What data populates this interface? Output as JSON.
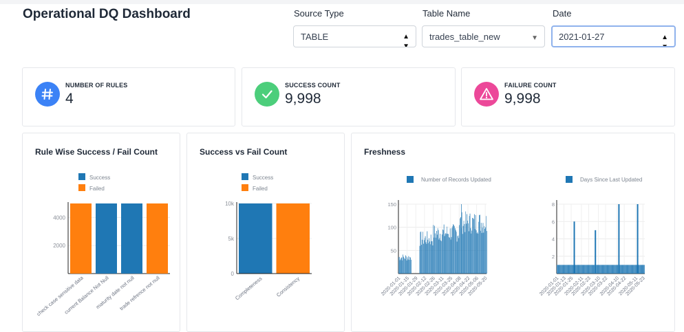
{
  "page": {
    "title": "Operational DQ Dashboard"
  },
  "filters": {
    "source_type": {
      "label": "Source Type",
      "value": "TABLE"
    },
    "table_name": {
      "label": "Table Name",
      "value": "trades_table_new"
    },
    "date": {
      "label": "Date",
      "value": "2021-01-27"
    }
  },
  "stats": {
    "rules": {
      "label": "NUMBER OF RULES",
      "value": "4",
      "icon": "hash-icon",
      "color": "#3b82f6"
    },
    "success": {
      "label": "SUCCESS COUNT",
      "value": "9,998",
      "icon": "check-icon",
      "color": "#4cce7b"
    },
    "failure": {
      "label": "FAILURE COUNT",
      "value": "9,998",
      "icon": "warning-icon",
      "color": "#ec4899"
    }
  },
  "colors": {
    "success": "#1f77b4",
    "failed": "#ff7f0e",
    "fresh": "#1f77b4"
  },
  "chart_titles": {
    "rule_wise": "Rule Wise Success / Fail Count",
    "success_vs_fail": "Success vs Fail Count",
    "freshness": "Freshness"
  },
  "chart_data": [
    {
      "type": "bar",
      "title": "Rule Wise Success / Fail Count",
      "legend": [
        "Success",
        "Failed"
      ],
      "legend_position": "top",
      "categories": [
        "check case sensitive data",
        "current Balance Not Null",
        "maturity date not null",
        "trade refrence not null"
      ],
      "values": [
        5000,
        5000,
        5000,
        5000
      ],
      "status": [
        "Failed",
        "Success",
        "Success",
        "Failed"
      ],
      "ylim": [
        0,
        5000
      ],
      "yticks": [
        "2000",
        "4000"
      ]
    },
    {
      "type": "bar",
      "title": "Success vs Fail Count",
      "legend": [
        "Success",
        "Failed"
      ],
      "legend_position": "top",
      "categories": [
        "Completeness",
        "Consistency"
      ],
      "values": [
        10000,
        10000
      ],
      "status": [
        "Success",
        "Failed"
      ],
      "ylim": [
        0,
        10000
      ],
      "yticks": [
        "0",
        "5k",
        "10k"
      ]
    },
    {
      "type": "bar",
      "title": "Number of Records Updated",
      "legend": [
        "Number of Records Updated"
      ],
      "ylim": [
        0,
        150
      ],
      "yticks": [
        "50",
        "100",
        "150"
      ],
      "xticks": [
        "2020-01-01",
        "2020-01-15",
        "2020-01-29",
        "2020-02-12",
        "2020-02-26",
        "2020-03-11",
        "2020-03-25",
        "2020-04-08",
        "2020-04-22",
        "2020-05-06",
        "2020-05-20"
      ],
      "segments": [
        {
          "start": "2020-01-01",
          "end": "2020-01-21",
          "value": 35
        },
        {
          "start": "2020-01-22",
          "end": "2020-02-03",
          "value": 0
        },
        {
          "start": "2020-02-04",
          "end": "2020-02-25",
          "value": 75
        },
        {
          "start": "2020-02-26",
          "end": "2020-04-07",
          "value": 88
        },
        {
          "start": "2020-04-08",
          "end": "2020-05-22",
          "value": 110
        }
      ],
      "peak": {
        "x": "2020-04-11",
        "value": 150
      }
    },
    {
      "type": "bar",
      "title": "Days Since Last Updated",
      "legend": [
        "Days Since Last Updated"
      ],
      "ylim": [
        0,
        8
      ],
      "yticks": [
        "2",
        "4",
        "6",
        "8"
      ],
      "xticks": [
        "2020-01-01",
        "2020-01-13",
        "2020-01-25",
        "2020-02-11",
        "2020-02-23",
        "2020-03-10",
        "2020-03-22",
        "2020-04-10",
        "2020-04-22",
        "2020-05-11",
        "2020-05-23"
      ],
      "baseline": 1,
      "spikes": [
        {
          "x": "2020-01-29",
          "value": 6
        },
        {
          "x": "2020-03-04",
          "value": 5
        },
        {
          "x": "2020-04-12",
          "value": 8
        },
        {
          "x": "2020-05-13",
          "value": 8
        }
      ]
    }
  ]
}
